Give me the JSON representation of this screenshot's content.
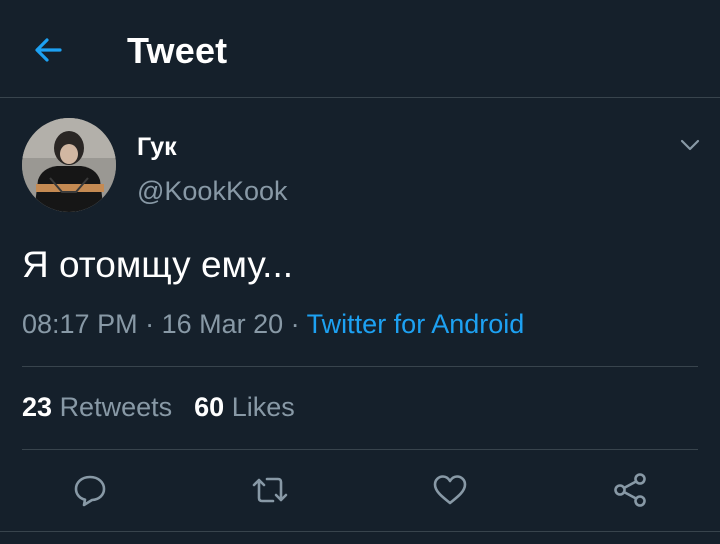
{
  "header": {
    "title": "Tweet",
    "back_icon": "arrow-left-icon"
  },
  "tweet": {
    "author_name": "Гук",
    "author_handle": "@KookKook",
    "text": "Я отомщу ему...",
    "time": "08:17 PM",
    "separator": " · ",
    "date": "16 Mar 20",
    "source": "Twitter for Android"
  },
  "stats": {
    "retweets_count": "23",
    "retweets_label": "Retweets",
    "likes_count": "60",
    "likes_label": "Likes"
  },
  "actions": [
    "reply-icon",
    "retweet-icon",
    "like-icon",
    "share-icon"
  ],
  "colors": {
    "background": "#15202b",
    "accent": "#1da1f2",
    "secondary_text": "#8899a6",
    "divider": "#38444d"
  }
}
